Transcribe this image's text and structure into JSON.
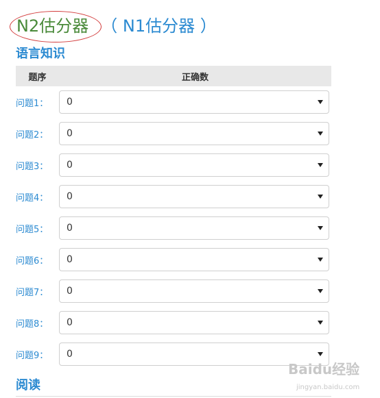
{
  "header": {
    "active_tab": "N2估分器",
    "other_tab": "（ N1估分器 ）"
  },
  "sections": {
    "language": "语言知识",
    "reading": "阅读"
  },
  "table": {
    "col_number": "题序",
    "col_correct": "正确数"
  },
  "questions": [
    {
      "label": "问题1：",
      "value": "0"
    },
    {
      "label": "问题2：",
      "value": "0"
    },
    {
      "label": "问题3：",
      "value": "0"
    },
    {
      "label": "问题4：",
      "value": "0"
    },
    {
      "label": "问题5：",
      "value": "0"
    },
    {
      "label": "问题6：",
      "value": "0"
    },
    {
      "label": "问题7：",
      "value": "0"
    },
    {
      "label": "问题8：",
      "value": "0"
    },
    {
      "label": "问题9：",
      "value": "0"
    }
  ],
  "watermark": {
    "main": "Baidu经验",
    "sub": "jingyan.baidu.com"
  },
  "colors": {
    "link_blue": "#2b8ad1",
    "active_green": "#4a8a3a",
    "annotation_red": "#d23a3a"
  }
}
